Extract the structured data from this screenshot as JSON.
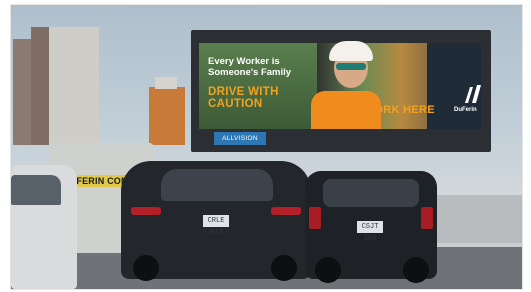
{
  "billboard": {
    "headline": "Every Worker is\nSomeone's Family",
    "slogan": "DRIVE WITH\nCAUTION",
    "tagline": "I WORK HERE",
    "brand_name": "DuFerin",
    "operator": "ALLVISION"
  },
  "truck": {
    "label": "DUFERIN CON"
  },
  "cars": {
    "plate_black": "CRLE 843",
    "plate_dark": "CSJT 203"
  },
  "colors": {
    "billboard_accent": "#f4a21b",
    "allvision_blue": "#2c77b4",
    "vest_orange": "#f08c1e"
  },
  "icons": {
    "brand": "duferin-logo-icon"
  }
}
